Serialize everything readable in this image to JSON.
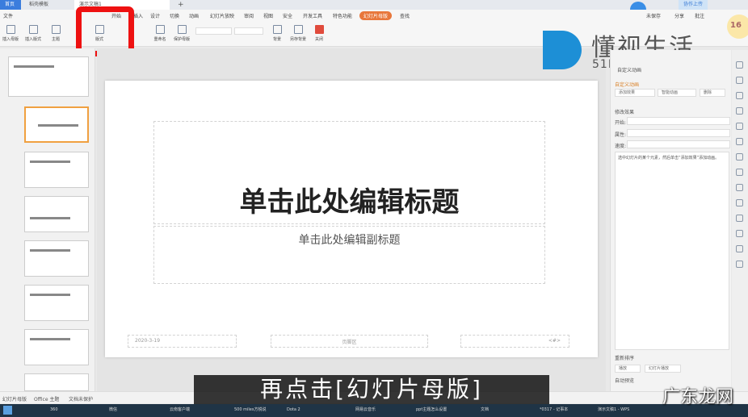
{
  "tabs": [
    {
      "label": "首页"
    },
    {
      "label": "稻壳模板"
    },
    {
      "label": "演示文稿1"
    }
  ],
  "menu": {
    "file": "文件",
    "items": [
      "开始",
      "插入",
      "设计",
      "切换",
      "动画",
      "幻灯片放映",
      "审阅",
      "视图",
      "安全",
      "开发工具",
      "特色功能",
      "幻灯片母版"
    ],
    "search": "查找"
  },
  "account": {
    "user": "未保存",
    "share": "分享",
    "comment": "批注",
    "sync": "协作上传"
  },
  "toolbar": [
    "插入母版",
    "插入版式",
    "主题",
    "",
    "版式",
    "重命名",
    "保护母版",
    "",
    "背景",
    "另存背景",
    "关闭"
  ],
  "slide": {
    "title": "单击此处编辑标题",
    "subtitle": "单击此处编辑副标题",
    "date": "2020-3-19",
    "footer": "页脚区",
    "page": "<#>"
  },
  "panel": {
    "title": "自定义动画",
    "section": "自定义动画",
    "add": "添加效果",
    "smart": "智能动画",
    "delete": "删除",
    "modify": "修改效果",
    "start": "开始:",
    "property": "属性:",
    "speed": "速度:",
    "hint": "选中幻灯片的某个元素，然后单击“添加效果”添加动画。",
    "reorder": "重新排序",
    "play": "播放",
    "preview": "幻灯片播放",
    "autopreview": "自动预览"
  },
  "status": {
    "view": "幻灯片母版",
    "theme": "Office 主题",
    "protect": "文档未保护"
  },
  "taskbar": [
    "360",
    "微信",
    "云南客户端",
    "500 miles方锐说",
    "Dota 2",
    "网易云音乐",
    "ppt主题怎么设置",
    "文档",
    "*0317 - 记事本",
    "演示文稿1 - WPS"
  ],
  "caption": "再点击[幻灯片母版]",
  "watermark": {
    "brand": "懂视生活",
    "url": "51DONGSHI.COM",
    "corner": "广东龙网"
  },
  "clock": "16"
}
